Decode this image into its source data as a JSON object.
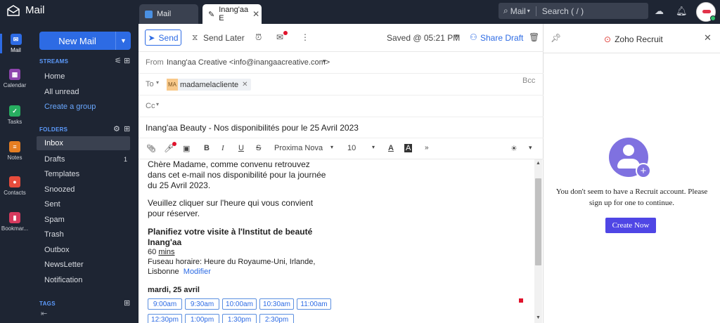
{
  "app": {
    "name": "Mail"
  },
  "tabs": [
    {
      "label": "Mail"
    },
    {
      "label": "Inang'aa E"
    }
  ],
  "search": {
    "scope": "Mail",
    "placeholder": "Search ( / )"
  },
  "rail": [
    {
      "label": "Mail"
    },
    {
      "label": "Calendar"
    },
    {
      "label": "Tasks"
    },
    {
      "label": "Notes"
    },
    {
      "label": "Contacts"
    },
    {
      "label": "Bookmar..."
    }
  ],
  "sidebar": {
    "new_mail": "New Mail",
    "streams_title": "STREAMS",
    "streams": [
      {
        "label": "Home"
      },
      {
        "label": "All unread"
      },
      {
        "label": "Create a group"
      }
    ],
    "folders_title": "FOLDERS",
    "folders": [
      {
        "label": "Inbox"
      },
      {
        "label": "Drafts",
        "count": "1"
      },
      {
        "label": "Templates"
      },
      {
        "label": "Snoozed"
      },
      {
        "label": "Sent"
      },
      {
        "label": "Spam"
      },
      {
        "label": "Trash"
      },
      {
        "label": "Outbox"
      },
      {
        "label": "NewsLetter"
      },
      {
        "label": "Notification"
      }
    ],
    "tags_title": "TAGS"
  },
  "compose": {
    "send": "Send",
    "send_later": "Send Later",
    "saved": "Saved @ 05:21 PM",
    "share_draft": "Share Draft",
    "from_label": "From",
    "from_value": "Inang'aa Creative <info@inangaacreative.com>",
    "to_label": "To",
    "to_chip_initials": "MA",
    "to_chip": "madamelacliente",
    "bcc": "Bcc",
    "cc_label": "Cc",
    "subject": "Inang'aa Beauty - Nos disponibilités pour le 25 Avril 2023",
    "font": "Proxima Nova",
    "size": "10"
  },
  "body": {
    "p1_l1": "Chère Madame, comme convenu retrouvez",
    "p1_l2": "dans cet e-mail nos disponibilité pour la journée",
    "p1_l3": "du 25 Avril 2023.",
    "p2_l1": "Veuillez cliquer sur l'heure qui vous convient",
    "p2_l2": "pour réserver.",
    "h_l1": "Planifiez votre visite à l'Institut de beauté",
    "h_l2": "Inang'aa",
    "duration_num": "60",
    "duration_unit": "mins",
    "tz_l1": "Fuseau horaire: Heure du Royaume-Uni, Irlande,",
    "tz_l2": "Lisbonne",
    "modifier": "Modifier",
    "day": "mardi, 25 avril",
    "slots": [
      "9:00am",
      "9:30am",
      "10:00am",
      "10:30am",
      "11:00am",
      "12:30pm",
      "1:00pm",
      "1:30pm",
      "2:30pm"
    ]
  },
  "panel": {
    "title": "Zoho Recruit",
    "message_l1": "You don't seem to have a Recruit account. Please",
    "message_l2": "sign up for one to continue.",
    "button": "Create Now"
  }
}
